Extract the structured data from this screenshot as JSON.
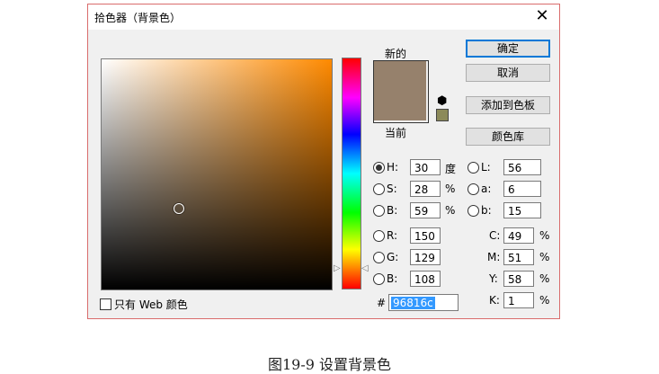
{
  "window": {
    "title": "拾色器（背景色）",
    "close_glyph": "✕"
  },
  "preview": {
    "new_label": "新的",
    "current_label": "当前",
    "new_color": "#96816c",
    "current_color": "#96816c",
    "gamut_swatch_color": "#8c8a5a"
  },
  "buttons": {
    "ok": "确定",
    "cancel": "取消",
    "add_swatch": "添加到色板",
    "libraries": "颜色库"
  },
  "hsb": [
    {
      "label": "H:",
      "value": "30",
      "unit": "度",
      "selected": true
    },
    {
      "label": "S:",
      "value": "28",
      "unit": "%",
      "selected": false
    },
    {
      "label": "B:",
      "value": "59",
      "unit": "%",
      "selected": false
    }
  ],
  "rgb": [
    {
      "label": "R:",
      "value": "150"
    },
    {
      "label": "G:",
      "value": "129"
    },
    {
      "label": "B:",
      "value": "108"
    }
  ],
  "lab": [
    {
      "label": "L:",
      "value": "56"
    },
    {
      "label": "a:",
      "value": "6"
    },
    {
      "label": "b:",
      "value": "15"
    }
  ],
  "cmyk": [
    {
      "label": "C:",
      "value": "49",
      "unit": "%"
    },
    {
      "label": "M:",
      "value": "51",
      "unit": "%"
    },
    {
      "label": "Y:",
      "value": "58",
      "unit": "%"
    },
    {
      "label": "K:",
      "value": "1",
      "unit": "%"
    }
  ],
  "hex": {
    "prefix": "#",
    "value": "96816c"
  },
  "web_only": {
    "label": "只有 Web 颜色",
    "checked": false
  },
  "caption": "图19-9  设置背景色"
}
